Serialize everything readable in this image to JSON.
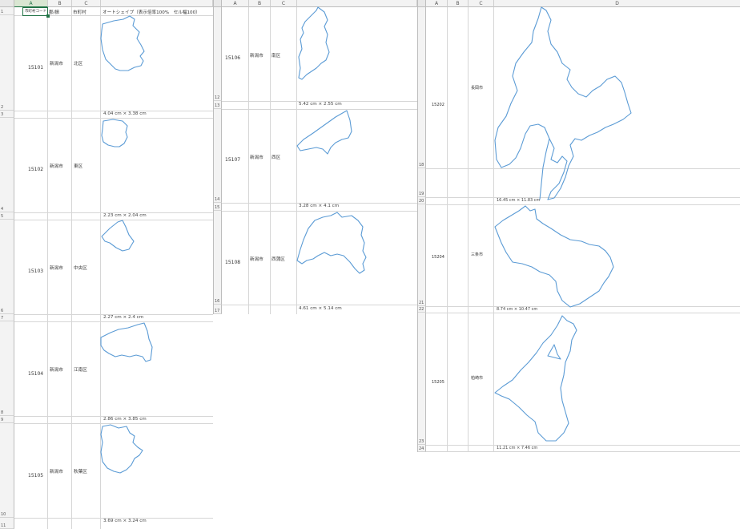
{
  "col_headers": {
    "a": "A",
    "b": "B",
    "c": "C",
    "d": "D"
  },
  "header_row": {
    "a": "市町村コード",
    "b": "郡/振",
    "c": "市町村",
    "d": "オートシェイプ（表示倍率100%　セル幅100）"
  },
  "left_rows": [
    {
      "row": "1"
    },
    {
      "row": "2"
    },
    {
      "row": "3"
    },
    {
      "row": "4"
    },
    {
      "row": "5"
    },
    {
      "row": "6"
    },
    {
      "row": "7"
    },
    {
      "row": "8"
    },
    {
      "row": "9"
    },
    {
      "row": "10"
    },
    {
      "row": "11"
    }
  ],
  "left_records": [
    {
      "code": "15101",
      "pref": "新潟市",
      "ward": "北区",
      "dims": "4.04 cm × 3.38 cm"
    },
    {
      "code": "15102",
      "pref": "新潟市",
      "ward": "東区",
      "dims": "2.23 cm × 2.04 cm"
    },
    {
      "code": "15103",
      "pref": "新潟市",
      "ward": "中央区",
      "dims": "2.27 cm × 2.4 cm"
    },
    {
      "code": "15104",
      "pref": "新潟市",
      "ward": "江南区",
      "dims": "2.86 cm × 3.85 cm"
    },
    {
      "code": "15105",
      "pref": "新潟市",
      "ward": "秋葉区",
      "dims": "3.69 cm × 3.24 cm"
    }
  ],
  "mid_rows": [
    "12",
    "13",
    "14",
    "15",
    "16",
    "17"
  ],
  "mid_records": [
    {
      "code": "15106",
      "pref": "新潟市",
      "ward": "南区",
      "dims": "5.42 cm × 2.55 cm"
    },
    {
      "code": "15107",
      "pref": "新潟市",
      "ward": "西区",
      "dims": "3.28 cm × 4.1 cm"
    },
    {
      "code": "15108",
      "pref": "新潟市",
      "ward": "西蒲区",
      "dims": "4.61 cm × 5.14 cm"
    }
  ],
  "right_rows": [
    "18",
    "19",
    "20",
    "21",
    "22",
    "23",
    "24"
  ],
  "right_records": [
    {
      "code": "15202",
      "city": "長岡市",
      "dims": "16.45 cm × 11.83 cm"
    },
    {
      "code": "15204",
      "city": "三条市",
      "dims": "8.74 cm × 10.47 cm"
    },
    {
      "code": "15205",
      "city": "柏崎市",
      "dims": "11.21 cm × 7.46 cm"
    }
  ],
  "accent": "#217346",
  "shape_stroke": "#5b9bd5"
}
